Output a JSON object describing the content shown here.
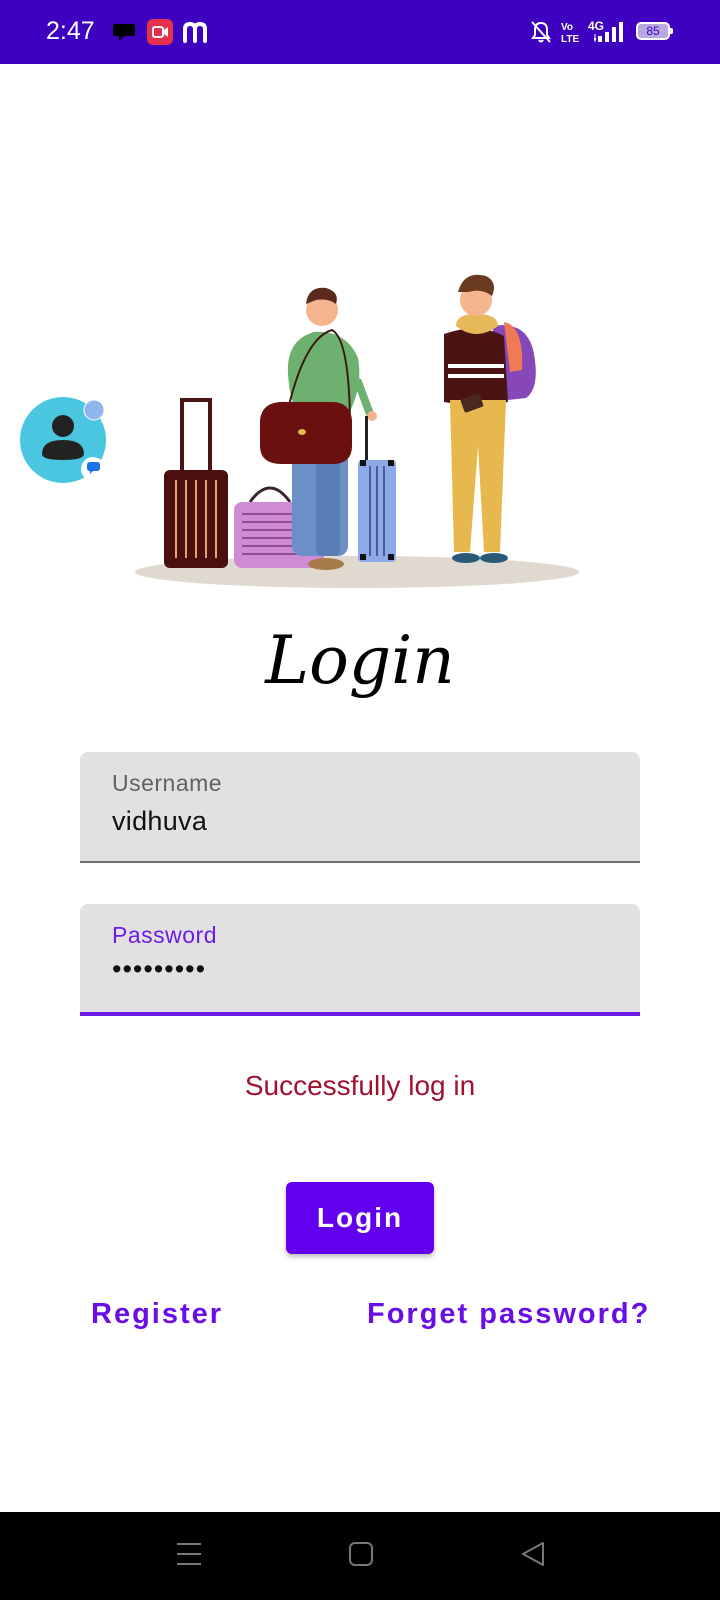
{
  "status_bar": {
    "time": "2:47",
    "battery_level": "85",
    "icons": [
      "chat-bubble-icon",
      "screen-record-icon",
      "m-app-icon",
      "bell-off-icon",
      "volte-icon",
      "4g-icon",
      "signal-icon",
      "battery-icon"
    ],
    "background_color": "#3d01bf"
  },
  "login": {
    "title": "Login",
    "username": {
      "label": "Username",
      "value": "vidhuva"
    },
    "password": {
      "label": "Password",
      "value": "•••••••••"
    },
    "status_message": "Successfully log in",
    "login_button": "Login",
    "register_link": "Register",
    "forgot_link": "Forget password?"
  },
  "colors": {
    "accent": "#6200ee",
    "message": "#a0112e"
  },
  "nav_bar": {
    "icons": [
      "menu-icon",
      "home-square-icon",
      "back-triangle-icon"
    ]
  }
}
